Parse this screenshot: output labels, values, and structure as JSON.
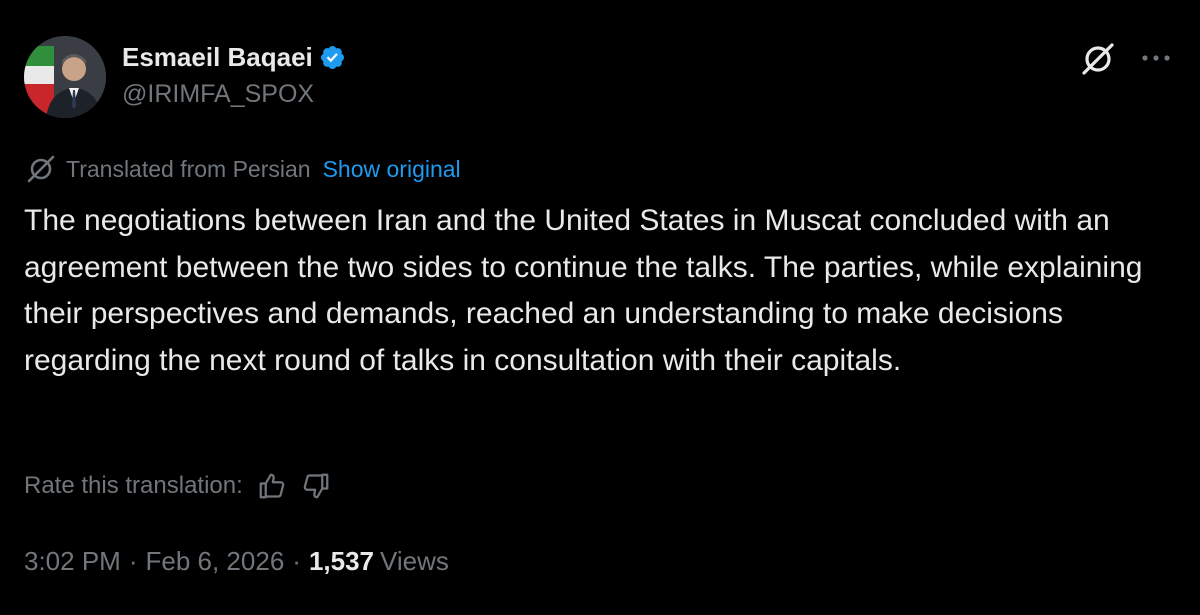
{
  "author": {
    "display_name": "Esmaeil Baqaei",
    "handle": "@IRIMFA_SPOX",
    "verified": true,
    "avatar_icon": "profile-photo"
  },
  "actions": {
    "grok_icon": "grok-icon",
    "more_icon": "more-horizontal-icon"
  },
  "translation": {
    "icon": "translate-icon",
    "label": "Translated from Persian",
    "show_original": "Show original"
  },
  "tweet": {
    "text": "The negotiations between Iran and the United States in Muscat concluded with an agreement between the two sides to continue the talks. The parties, while explaining their perspectives and demands, reached an understanding to make decisions regarding the next round of talks in consultation with their capitals."
  },
  "rate": {
    "label": "Rate this translation:",
    "thumbs_up_icon": "thumbs-up-icon",
    "thumbs_down_icon": "thumbs-down-icon"
  },
  "meta": {
    "time": "3:02 PM",
    "separator": "·",
    "date": "Feb 6, 2026",
    "views_count": "1,537",
    "views_label": "Views"
  },
  "colors": {
    "background": "#000000",
    "text_primary": "#e7e9ea",
    "text_secondary": "#71767b",
    "link": "#1d9bf0",
    "verified_badge": "#1d9bf0"
  }
}
